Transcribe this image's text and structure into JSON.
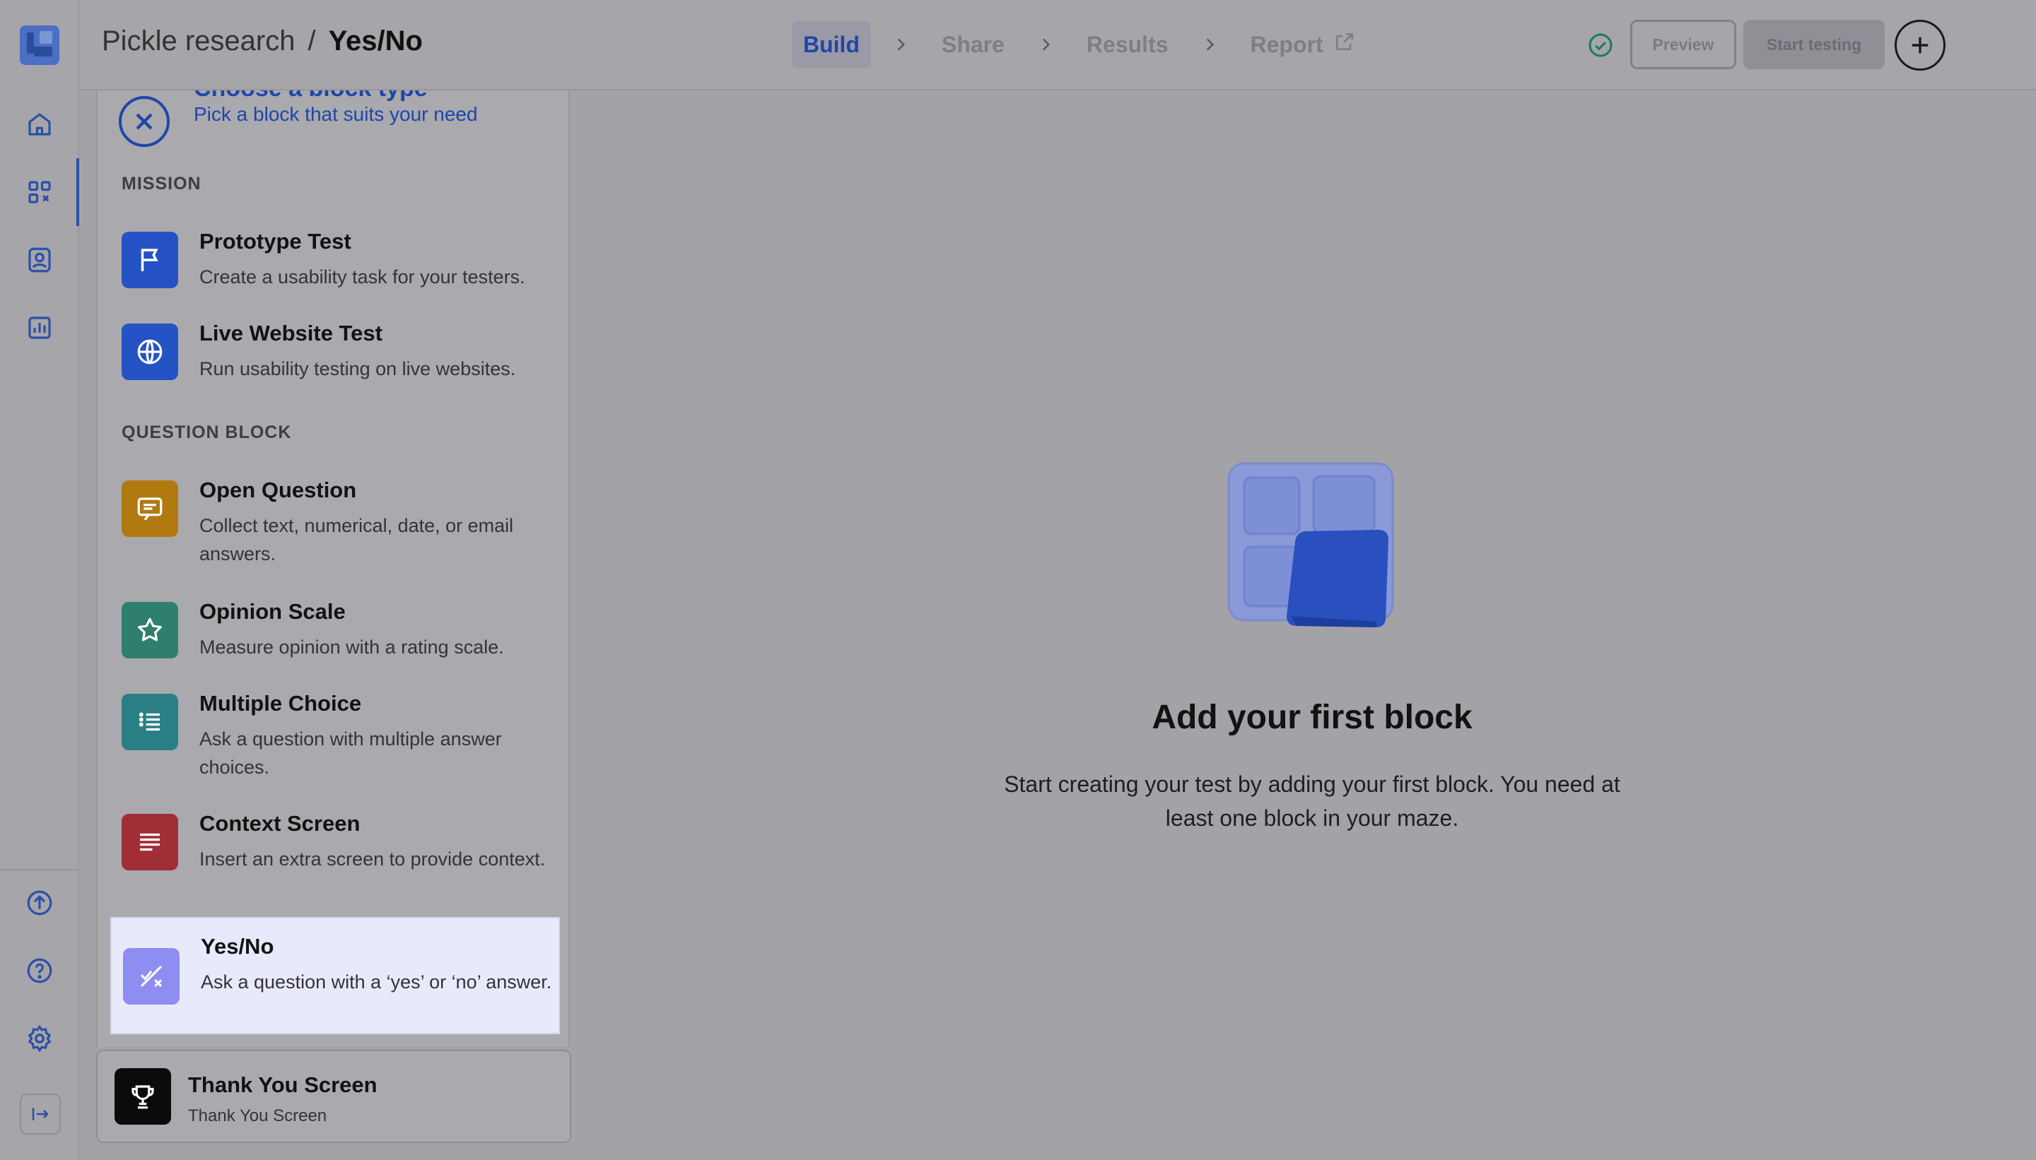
{
  "header": {
    "project": "Pickle research",
    "separator": "/",
    "current_block": "Yes/No",
    "steps": [
      {
        "label": "Build",
        "active": true
      },
      {
        "label": "Share",
        "active": false
      },
      {
        "label": "Results",
        "active": false
      },
      {
        "label": "Report",
        "active": false
      }
    ],
    "preview_label": "Preview",
    "start_label": "Start testing"
  },
  "sidebar_rail": {
    "icons": [
      "home-icon",
      "blocks-icon",
      "testers-icon",
      "analytics-icon",
      "upload-icon",
      "help-icon",
      "settings-icon",
      "collapse-icon"
    ],
    "active": "blocks-icon"
  },
  "panel": {
    "title": "Choose a block type",
    "subtitle": "Pick a block that suits your need",
    "sections": [
      {
        "label": "MISSION",
        "blocks": [
          {
            "title": "Prototype Test",
            "desc": "Create a usability task for your testers.",
            "icon": "flag-icon",
            "color": "#2552c4"
          },
          {
            "title": "Live Website Test",
            "desc": "Run usability testing on live websites.",
            "icon": "globe-icon",
            "color": "#2552c4"
          }
        ]
      },
      {
        "label": "QUESTION BLOCK",
        "blocks": [
          {
            "title": "Open Question",
            "desc": "Collect text, numerical, date, or email answers.",
            "icon": "comment-icon",
            "color": "#b07a10"
          },
          {
            "title": "Opinion Scale",
            "desc": "Measure opinion with a rating scale.",
            "icon": "star-icon",
            "color": "#2e7f6e"
          },
          {
            "title": "Multiple Choice",
            "desc": "Ask a question with multiple answer choices.",
            "icon": "list-icon",
            "color": "#2a7f84"
          },
          {
            "title": "Context Screen",
            "desc": "Insert an extra screen to provide context.",
            "icon": "text-lines-icon",
            "color": "#a22e35"
          },
          {
            "title": "Yes/No",
            "desc": "Ask a question with a ‘yes’ or ‘no’ answer.",
            "icon": "yes-no-icon",
            "color": "#8f8cf2",
            "selected": true
          }
        ]
      }
    ]
  },
  "thank_you": {
    "title": "Thank You Screen",
    "subtitle": "Thank You Screen",
    "icon": "trophy-icon"
  },
  "empty_state": {
    "title": "Add your first block",
    "description": "Start creating your test by adding your first block. You need at least one block in your maze."
  },
  "colors": {
    "accent": "#1f46a8",
    "overlay_bg": "#a3a3a7",
    "selected_bg": "#e9e9fc",
    "success": "#1c7a5a"
  }
}
